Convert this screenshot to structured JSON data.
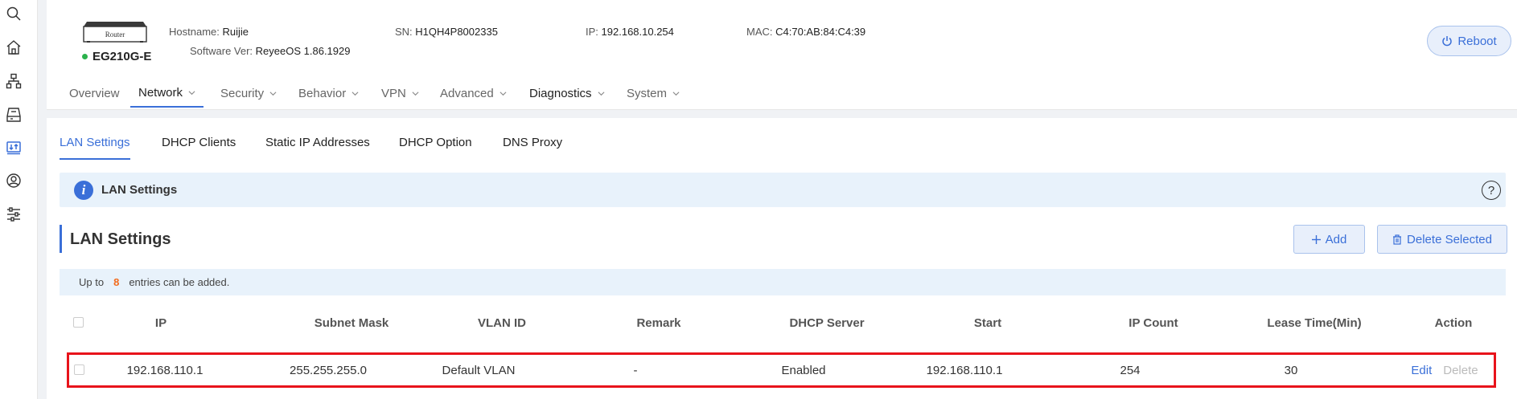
{
  "rail": {
    "icons": [
      "search-icon",
      "home-icon",
      "topology-icon",
      "device-icon",
      "network-icon",
      "user-icon",
      "settings-sliders-icon"
    ],
    "active_index": 4,
    "accent": "#3a6fd8"
  },
  "device": {
    "router_label": "Router",
    "model": "EG210G-E",
    "status_color": "#2bb24c",
    "hostname_label": "Hostname:",
    "hostname": "Ruijie",
    "software_label": "Software Ver:",
    "software": "ReyeeOS 1.86.1929",
    "sn_label": "SN:",
    "sn": "H1QH4P8002335",
    "ip_label": "IP:",
    "ip": "192.168.10.254",
    "mac_label": "MAC:",
    "mac": "C4:70:AB:84:C4:39",
    "reboot_label": "Reboot"
  },
  "topnav": {
    "items": [
      {
        "label": "Overview",
        "dropdown": false
      },
      {
        "label": "Network",
        "dropdown": true,
        "active": true
      },
      {
        "label": "Security",
        "dropdown": true
      },
      {
        "label": "Behavior",
        "dropdown": true
      },
      {
        "label": "VPN",
        "dropdown": true
      },
      {
        "label": "Advanced",
        "dropdown": true
      },
      {
        "label": "Diagnostics",
        "dropdown": true
      },
      {
        "label": "System",
        "dropdown": true
      }
    ]
  },
  "tabs": [
    "LAN Settings",
    "DHCP Clients",
    "Static IP Addresses",
    "DHCP Option",
    "DNS Proxy"
  ],
  "info": {
    "title": "LAN Settings",
    "help_glyph": "?"
  },
  "section": {
    "title": "LAN Settings",
    "add_label": "Add",
    "delete_selected_label": "Delete Selected"
  },
  "limit": {
    "prefix": "Up to",
    "count": "8",
    "suffix": "entries can be added."
  },
  "table": {
    "columns": [
      "IP",
      "Subnet Mask",
      "VLAN ID",
      "Remark",
      "DHCP Server",
      "Start",
      "IP Count",
      "Lease Time(Min)",
      "Action"
    ],
    "rows": [
      {
        "ip": "192.168.110.1",
        "mask": "255.255.255.0",
        "vlan": "Default VLAN",
        "remark": "-",
        "dhcp": "Enabled",
        "start": "192.168.110.1",
        "count": "254",
        "lease": "30",
        "edit": "Edit",
        "delete": "Delete"
      }
    ],
    "highlight_color": "#e8131b"
  }
}
